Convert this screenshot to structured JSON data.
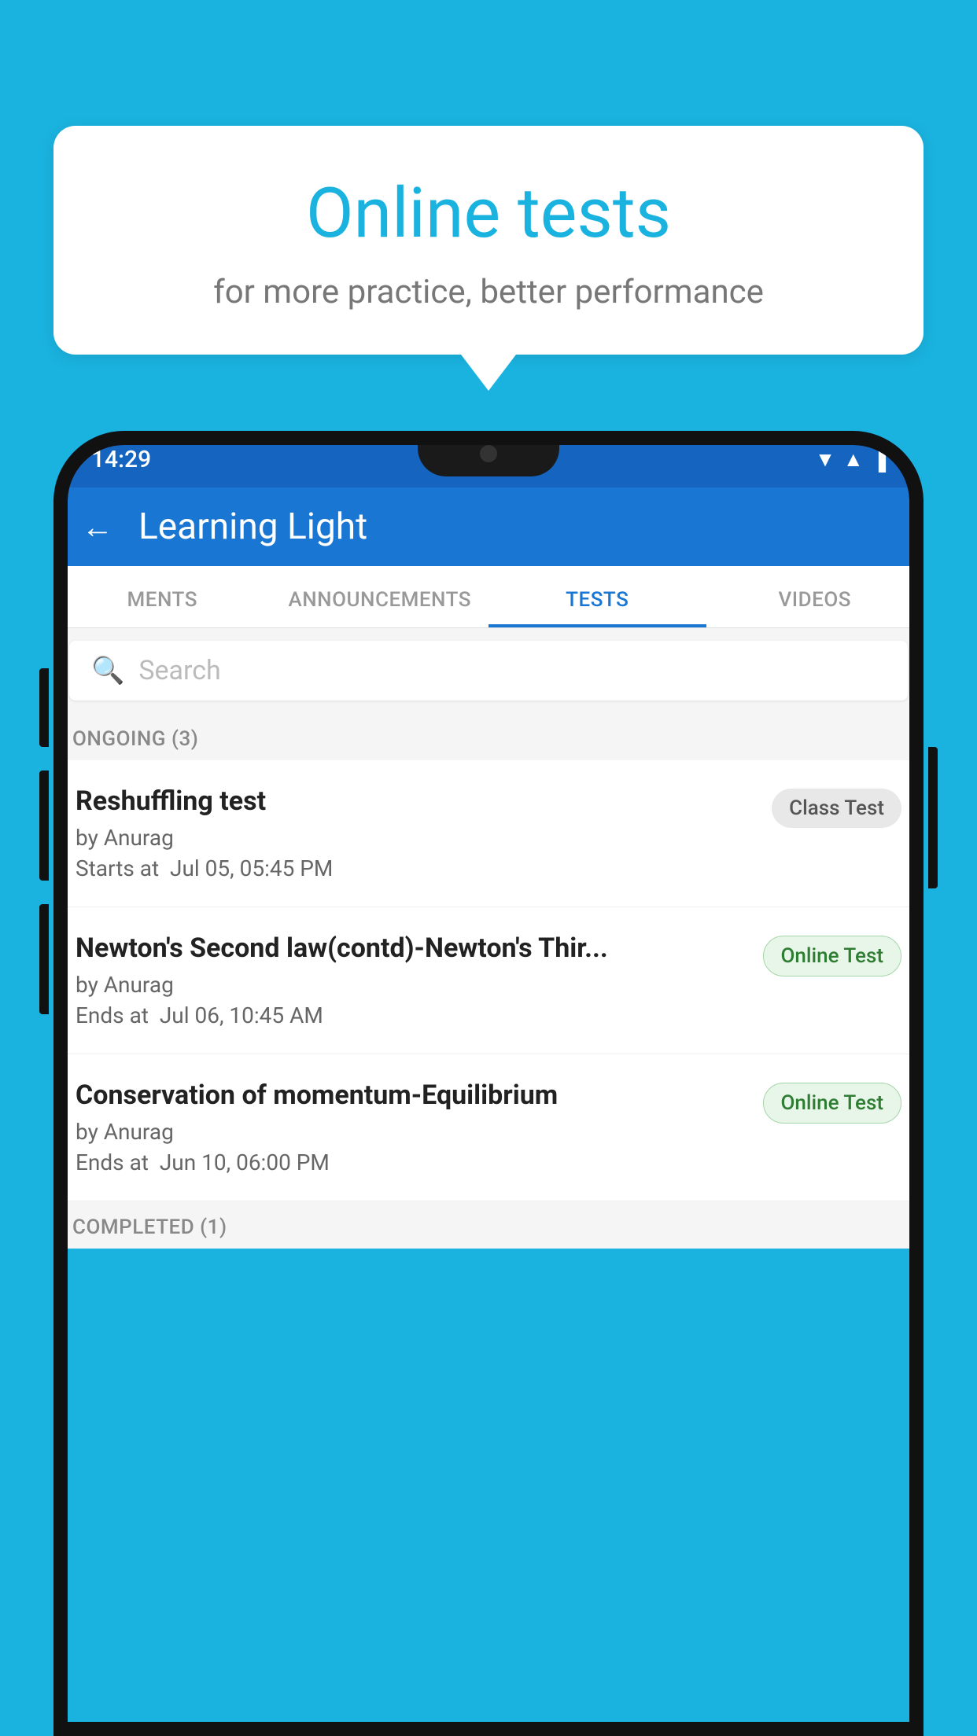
{
  "background_color": "#1ab3e0",
  "speech_bubble": {
    "title": "Online tests",
    "subtitle": "for more practice, better performance"
  },
  "phone": {
    "status_bar": {
      "time": "14:29",
      "icons": [
        "▼",
        "▲",
        "▐"
      ]
    },
    "app_header": {
      "back_label": "←",
      "title": "Learning Light"
    },
    "tabs": [
      {
        "label": "MENTS",
        "active": false
      },
      {
        "label": "ANNOUNCEMENTS",
        "active": false
      },
      {
        "label": "TESTS",
        "active": true
      },
      {
        "label": "VIDEOS",
        "active": false
      }
    ],
    "search": {
      "placeholder": "Search",
      "icon": "🔍"
    },
    "sections": {
      "ongoing": {
        "header": "ONGOING (3)",
        "items": [
          {
            "name": "Reshuffling test",
            "author": "by Anurag",
            "time_label": "Starts at",
            "time": "Jul 05, 05:45 PM",
            "badge": "Class Test",
            "badge_type": "class"
          },
          {
            "name": "Newton's Second law(contd)-Newton's Thir...",
            "author": "by Anurag",
            "time_label": "Ends at",
            "time": "Jul 06, 10:45 AM",
            "badge": "Online Test",
            "badge_type": "online"
          },
          {
            "name": "Conservation of momentum-Equilibrium",
            "author": "by Anurag",
            "time_label": "Ends at",
            "time": "Jun 10, 06:00 PM",
            "badge": "Online Test",
            "badge_type": "online"
          }
        ]
      },
      "completed": {
        "header": "COMPLETED (1)"
      }
    }
  }
}
